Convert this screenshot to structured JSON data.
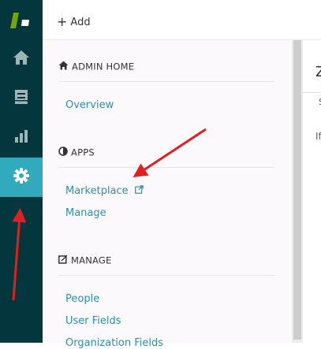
{
  "topbar": {
    "add_label": "Add"
  },
  "leftnav": {
    "items": [
      {
        "icon": "home-icon"
      },
      {
        "icon": "views-icon"
      },
      {
        "icon": "reports-icon"
      },
      {
        "icon": "gear-icon",
        "active": true
      }
    ]
  },
  "adminmenu": {
    "admin_home": {
      "header": "ADMIN HOME",
      "links": [
        "Overview"
      ]
    },
    "apps": {
      "header": "APPS",
      "links": [
        "Marketplace",
        "Manage"
      ]
    },
    "manage": {
      "header": "MANAGE",
      "links": [
        "People",
        "User Fields",
        "Organization Fields"
      ]
    }
  },
  "right": {
    "title_partial": "Z",
    "tab_partial": "S",
    "text_partial": "If"
  },
  "colors": {
    "nav_bg": "#04363d",
    "nav_active": "#30aabc",
    "link": "#2e8fab",
    "annotation_arrow": "#e02020"
  }
}
